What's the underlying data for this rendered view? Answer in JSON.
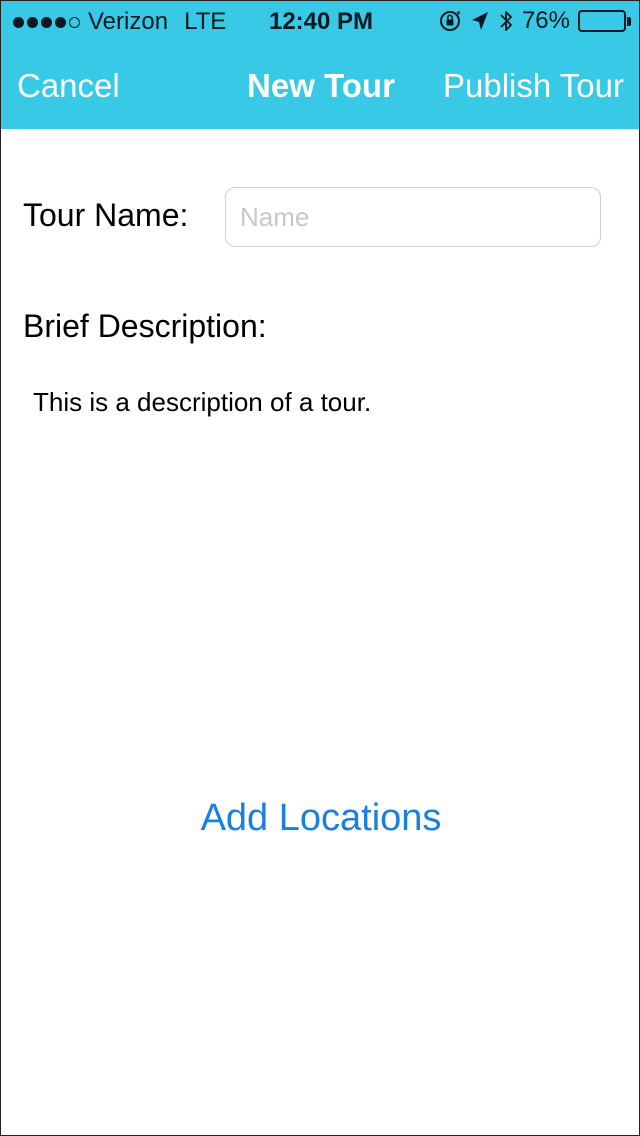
{
  "status_bar": {
    "carrier": "Verizon",
    "network": "LTE",
    "time": "12:40 PM",
    "battery_percent": "76%",
    "battery_level": 0.76,
    "signal_bars_filled": 4,
    "signal_bars_total": 5,
    "icons": [
      "orientation-lock-icon",
      "location-arrow-icon",
      "bluetooth-icon",
      "battery-icon"
    ]
  },
  "nav": {
    "cancel_label": "Cancel",
    "title": "New Tour",
    "publish_label": "Publish Tour"
  },
  "form": {
    "tour_name_label": "Tour Name:",
    "tour_name_value": "",
    "tour_name_placeholder": "Name",
    "description_label": "Brief Description:",
    "description_text": "This is a description of a tour."
  },
  "actions": {
    "add_locations_label": "Add Locations"
  },
  "colors": {
    "nav_background": "#37c9e6",
    "nav_text": "#ffffff",
    "link_blue": "#1a7fe0"
  }
}
